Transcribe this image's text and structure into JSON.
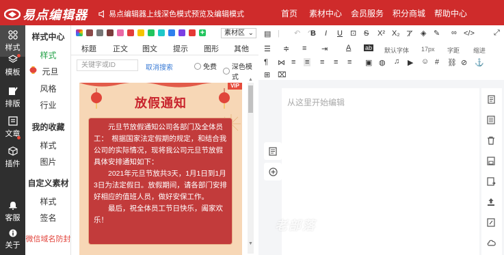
{
  "header": {
    "logo_text": "易点编辑器",
    "notice": "易点编辑器上线深色模式预览及编辑模式",
    "nav": [
      "首页",
      "素材中心",
      "会员服务",
      "积分商城",
      "帮助中心"
    ]
  },
  "iconbar": {
    "items": [
      {
        "label": "样式",
        "icon": "grid-icon",
        "active": true
      },
      {
        "label": "模板",
        "icon": "layers-icon"
      },
      {
        "label": "排版",
        "icon": "edit-icon"
      },
      {
        "label": "文章",
        "icon": "article-icon"
      },
      {
        "label": "插件",
        "icon": "cube-icon"
      },
      {
        "label": "客服",
        "icon": "bell-icon"
      },
      {
        "label": "关于",
        "icon": "info-icon"
      }
    ]
  },
  "category_menu": {
    "style_center": "样式中心",
    "style": "样式",
    "yuandan": "元旦",
    "fengge": "风格",
    "hangye": "行业",
    "my_fav": "我的收藏",
    "fav_style": "样式",
    "fav_image": "图片",
    "custom": "自定义素材",
    "custom_style": "样式",
    "custom_sign": "签名",
    "anti_block": "微信域名防封"
  },
  "palette": {
    "colors": [
      "#8b4a4a",
      "#777777",
      "#7a3c3c",
      "#e96aa6",
      "#e23c3c",
      "#f5c400",
      "#22c55e",
      "#1ec8c8",
      "#2f80ed",
      "#7b3fe4",
      "#e53935"
    ],
    "material_select": "素材区",
    "tabs": [
      "标题",
      "正文",
      "图文",
      "提示",
      "图形",
      "其他"
    ],
    "search_placeholder": "关键字或ID",
    "search_link": "取消搜索",
    "radio_free": "免费",
    "radio_dark": "深色模式"
  },
  "template": {
    "vip": "VIP",
    "title": "放假通知",
    "para1": "元旦节放假通知公司各部门及全体员工：　根据国家法定假期的规定，和结合我公司的实际情况，现将我公司元旦节放假具体安排通知如下：",
    "para2": "2021年元旦节放共3天，1月1日到1月3日为法定假日。放假期间，请各部门安排好相应的值班人员，做好安保工作。",
    "para3": "最后，祝全体员工节日快乐，阖家欢乐！"
  },
  "editor": {
    "font_family": "默认字体",
    "font_size": "17px",
    "letter_spacing": "字距",
    "indent": "缩进",
    "placeholder": "从这里开始编辑"
  },
  "watermark": "老部落"
}
